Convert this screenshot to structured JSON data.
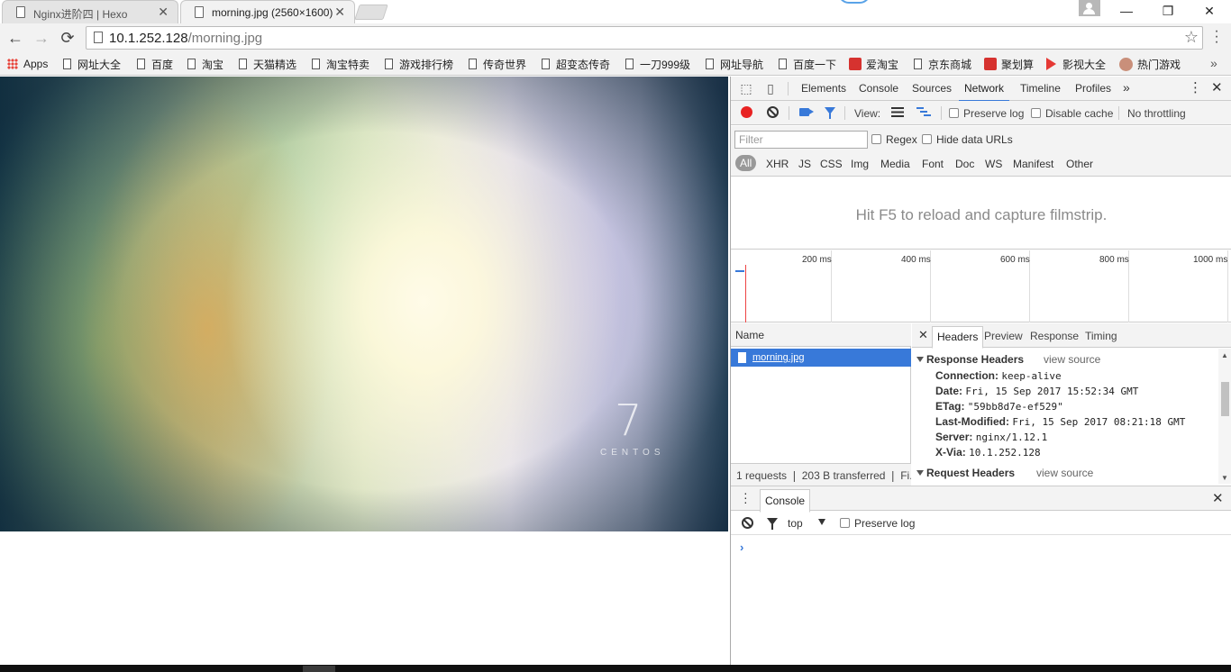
{
  "browser": {
    "tabs": [
      {
        "title": "Nginx进阶四 | Hexo",
        "close": "✕"
      },
      {
        "title": "morning.jpg (2560×1600)",
        "close": "✕"
      }
    ],
    "window_controls": {
      "minimize": "—",
      "maximize": "❐",
      "close": "✕"
    },
    "nav": {
      "back": "←",
      "forward": "→",
      "reload": "⟳"
    },
    "omnibox": {
      "host": "10.1.252.128",
      "path": "/morning.jpg",
      "star": "☆"
    },
    "menu": "⋮"
  },
  "bookmarks": {
    "items": [
      {
        "label": "Apps",
        "icon": "apps-grid-icon"
      },
      {
        "label": "网址大全",
        "icon": "folder-icon"
      },
      {
        "label": "百度",
        "icon": "folder-icon"
      },
      {
        "label": "淘宝",
        "icon": "folder-icon"
      },
      {
        "label": "天猫精选",
        "icon": "folder-icon"
      },
      {
        "label": "淘宝特卖",
        "icon": "folder-icon"
      },
      {
        "label": "游戏排行榜",
        "icon": "folder-icon"
      },
      {
        "label": "传奇世界",
        "icon": "folder-icon"
      },
      {
        "label": "超变态传奇",
        "icon": "folder-icon"
      },
      {
        "label": "一刀999级",
        "icon": "folder-icon"
      },
      {
        "label": "网址导航",
        "icon": "folder-icon"
      },
      {
        "label": "百度一下",
        "icon": "folder-icon"
      },
      {
        "label": "爱淘宝",
        "icon": "taobao-icon"
      },
      {
        "label": "京东商城",
        "icon": "folder-icon"
      },
      {
        "label": "聚划算",
        "icon": "juhuasuan-icon"
      },
      {
        "label": "影视大全",
        "icon": "play-icon"
      },
      {
        "label": "热门游戏",
        "icon": "avatar-icon"
      }
    ],
    "more": "»"
  },
  "page": {
    "image_seven": "7",
    "image_word": "CENTOS"
  },
  "devtools": {
    "panel_tabs": [
      "Elements",
      "Console",
      "Sources",
      "Network",
      "Timeline",
      "Profiles"
    ],
    "active_panel": "Network",
    "more_tabs": "»",
    "menu": "⋮",
    "close": "✕",
    "network_toolbar": {
      "view_label": "View:",
      "preserve_log": "Preserve log",
      "disable_cache": "Disable cache",
      "throttling": "No throttling"
    },
    "filter": {
      "placeholder": "Filter",
      "regex": "Regex",
      "hide_data_urls": "Hide data URLs",
      "types": [
        "All",
        "XHR",
        "JS",
        "CSS",
        "Img",
        "Media",
        "Font",
        "Doc",
        "WS",
        "Manifest",
        "Other"
      ]
    },
    "filmstrip_message": "Hit F5 to reload and capture filmstrip.",
    "overview_ticks": [
      "200 ms",
      "400 ms",
      "600 ms",
      "800 ms",
      "1000 ms"
    ],
    "requests": {
      "column": "Name",
      "rows": [
        {
          "name": "morning.jpg"
        }
      ],
      "status": "1 requests ❘ 203 B transferred ❘ Fi..."
    },
    "details": {
      "close": "✕",
      "tabs": [
        "Headers",
        "Preview",
        "Response",
        "Timing"
      ],
      "active_tab": "Headers",
      "response_headers_title": "Response Headers",
      "request_headers_title": "Request Headers",
      "view_source": "view source",
      "response_headers": [
        {
          "key": "Connection:",
          "value": "keep-alive"
        },
        {
          "key": "Date:",
          "value": "Fri, 15 Sep 2017 15:52:34 GMT"
        },
        {
          "key": "ETag:",
          "value": "\"59bb8d7e-ef529\""
        },
        {
          "key": "Last-Modified:",
          "value": "Fri, 15 Sep 2017 08:21:18 GMT"
        },
        {
          "key": "Server:",
          "value": "nginx/1.12.1"
        },
        {
          "key": "X-Via:",
          "value": "10.1.252.128"
        }
      ]
    },
    "drawer": {
      "menu": "⋮",
      "tab": "Console",
      "close": "✕",
      "context": "top",
      "preserve_log": "Preserve log",
      "prompt": "›"
    }
  }
}
